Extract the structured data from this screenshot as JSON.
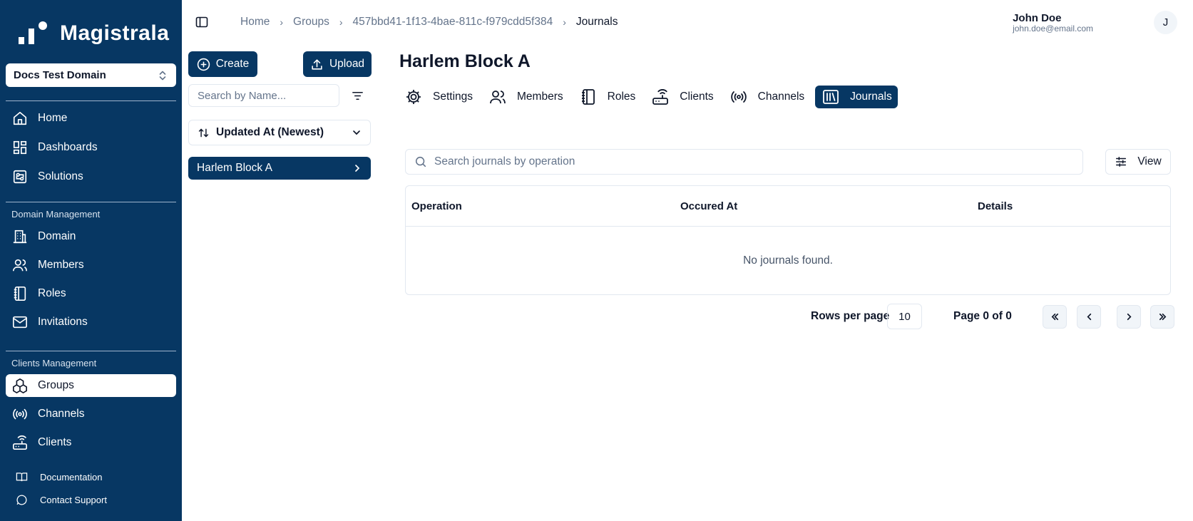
{
  "app": {
    "name": "Magistrala",
    "domain_selector": "Docs Test Domain"
  },
  "sidebar": {
    "main_items": [
      {
        "label": "Home",
        "icon": "home-icon"
      },
      {
        "label": "Dashboards",
        "icon": "dashboard-icon"
      },
      {
        "label": "Solutions",
        "icon": "solutions-icon"
      }
    ],
    "domain_section": "Domain Management",
    "domain_items": [
      {
        "label": "Domain",
        "icon": "building-icon"
      },
      {
        "label": "Members",
        "icon": "users-icon"
      },
      {
        "label": "Roles",
        "icon": "notebook-icon"
      },
      {
        "label": "Invitations",
        "icon": "mail-icon"
      }
    ],
    "clients_section": "Clients Management",
    "clients_items": [
      {
        "label": "Groups",
        "icon": "boxes-icon",
        "active": true
      },
      {
        "label": "Channels",
        "icon": "radio-icon"
      },
      {
        "label": "Clients",
        "icon": "router-icon"
      }
    ],
    "footer_items": [
      {
        "label": "Documentation",
        "icon": "book-icon"
      },
      {
        "label": "Contact Support",
        "icon": "message-icon"
      }
    ]
  },
  "header": {
    "breadcrumb": [
      "Home",
      "Groups",
      "457bbd41-1f13-4bae-811c-f979cdd5f384",
      "Journals"
    ],
    "user": {
      "name": "John Doe",
      "email": "john.doe@email.com",
      "initial": "J"
    }
  },
  "left_panel": {
    "create_label": "Create",
    "upload_label": "Upload",
    "search_placeholder": "Search by Name...",
    "sort_label": "Updated At (Newest)",
    "groups": [
      "Harlem Block A"
    ]
  },
  "main": {
    "title": "Harlem Block A",
    "tabs": [
      {
        "label": "Settings",
        "icon": "gear-icon"
      },
      {
        "label": "Members",
        "icon": "users-icon"
      },
      {
        "label": "Roles",
        "icon": "notebook-icon"
      },
      {
        "label": "Clients",
        "icon": "router-icon"
      },
      {
        "label": "Channels",
        "icon": "radio-icon"
      },
      {
        "label": "Journals",
        "icon": "library-icon",
        "active": true
      }
    ],
    "search_placeholder": "Search journals by operation",
    "view_label": "View",
    "table": {
      "columns": [
        "Operation",
        "Occured At",
        "Details"
      ],
      "empty_text": "No journals found."
    },
    "pagination": {
      "rows_label": "Rows per page",
      "rows_value": "10",
      "page_info": "Page 0 of 0"
    }
  },
  "colors": {
    "brand": "#073763",
    "border": "#e2e8f0",
    "muted": "#64748b"
  }
}
